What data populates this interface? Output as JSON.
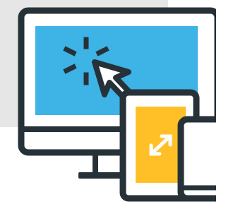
{
  "illustration": {
    "icons": [
      "monitor-icon",
      "click-cursor-icon",
      "tablet-icon",
      "expand-arrows-icon",
      "phone-icon"
    ],
    "colors": {
      "outline": "#263238",
      "monitor_screen": "#3db3e6",
      "tablet_screen": "#ffc027",
      "background_panel": "#e6e6e6",
      "device_body": "#ffffff",
      "cursor_arrow": "#ffffff",
      "expand_arrows": "#ffffff"
    }
  }
}
